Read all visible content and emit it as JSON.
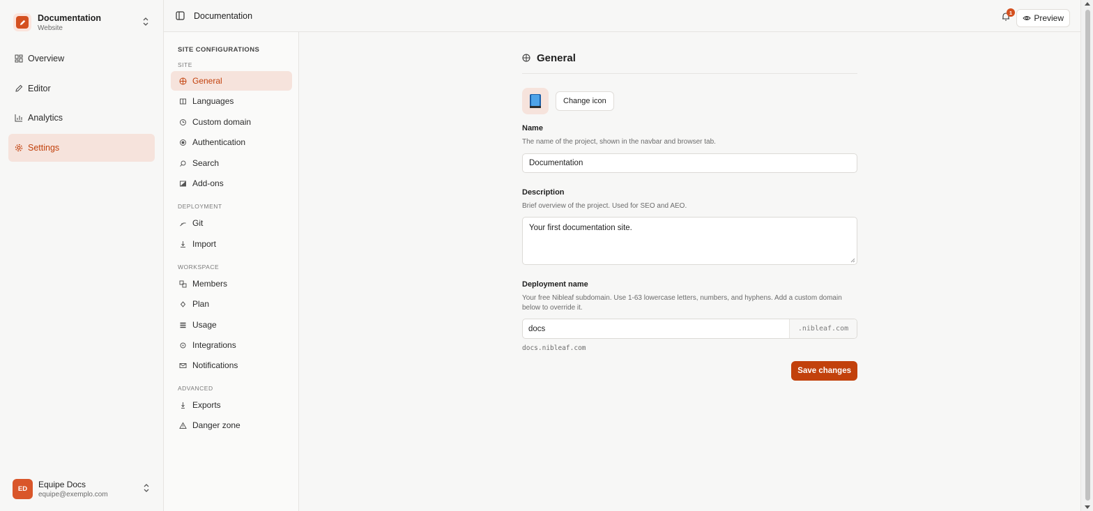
{
  "project": {
    "name": "Documentation",
    "subtitle": "Website",
    "icon": "pencil-icon"
  },
  "nav": {
    "items": [
      {
        "label": "Overview",
        "icon": "layout-grid-icon",
        "active": false
      },
      {
        "label": "Editor",
        "icon": "pencil-icon",
        "active": false
      },
      {
        "label": "Analytics",
        "icon": "bar-chart-icon",
        "active": false
      },
      {
        "label": "Settings",
        "icon": "gear-icon",
        "active": true
      }
    ]
  },
  "user": {
    "initials": "ED",
    "name": "Equipe Docs",
    "email": "equipe@exemplo.com"
  },
  "topbar": {
    "title": "Documentation",
    "notification_count": "1",
    "preview_label": "Preview"
  },
  "settings_nav": {
    "heading": "SITE CONFIGURATIONS",
    "groups": [
      {
        "label": "SITE",
        "items": [
          {
            "label": "General",
            "icon": "globe-icon",
            "active": true
          },
          {
            "label": "Languages",
            "icon": "book-icon"
          },
          {
            "label": "Custom domain",
            "icon": "clock-icon"
          },
          {
            "label": "Authentication",
            "icon": "lock-icon"
          },
          {
            "label": "Search",
            "icon": "search-icon"
          },
          {
            "label": "Add-ons",
            "icon": "puzzle-icon"
          }
        ]
      },
      {
        "label": "DEPLOYMENT",
        "items": [
          {
            "label": "Git",
            "icon": "git-branch-icon"
          },
          {
            "label": "Import",
            "icon": "download-icon"
          }
        ]
      },
      {
        "label": "WORKSPACE",
        "items": [
          {
            "label": "Members",
            "icon": "users-icon"
          },
          {
            "label": "Plan",
            "icon": "diamond-icon"
          },
          {
            "label": "Usage",
            "icon": "list-icon"
          },
          {
            "label": "Integrations",
            "icon": "plug-icon"
          },
          {
            "label": "Notifications",
            "icon": "mail-icon"
          }
        ]
      },
      {
        "label": "ADVANCED",
        "items": [
          {
            "label": "Exports",
            "icon": "export-icon"
          },
          {
            "label": "Danger zone",
            "icon": "warning-icon"
          }
        ]
      }
    ]
  },
  "general": {
    "title": "General",
    "change_icon_label": "Change icon",
    "site_icon": "book-emoji-icon",
    "name": {
      "label": "Name",
      "help": "The name of the project, shown in the navbar and browser tab.",
      "value": "Documentation"
    },
    "description": {
      "label": "Description",
      "help": "Brief overview of the project. Used for SEO and AEO.",
      "value": "Your first documentation site."
    },
    "deployment": {
      "label": "Deployment name",
      "help": "Your free Nibleaf subdomain. Use 1-63 lowercase letters, numbers, and hyphens. Add a custom domain below to override it.",
      "value": "docs",
      "suffix": ".nibleaf.com",
      "preview": "docs.nibleaf.com"
    },
    "save_label": "Save changes"
  },
  "colors": {
    "accent": "#c2410c",
    "accent_soft": "#f6e3dc"
  }
}
